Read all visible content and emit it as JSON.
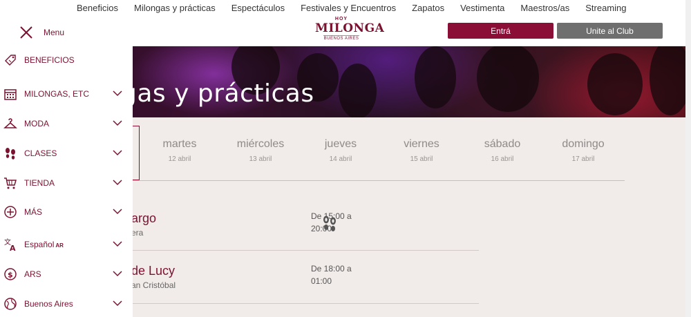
{
  "topnav": {
    "items": [
      "Beneficios",
      "Milongas y prácticas",
      "Espectáculos",
      "Festivales y Encuentros",
      "Zapatos",
      "Vestimenta",
      "Maestros/as",
      "Streaming"
    ]
  },
  "header": {
    "logo_top": "HOY",
    "logo_main": "MILONGA",
    "logo_bottom": "BUENOS AIRES",
    "login_label": "Entrá",
    "join_label": "Unite al Club"
  },
  "hero": {
    "title": "gas y prácticas"
  },
  "days": [
    {
      "name": "martes",
      "date": "12 abril"
    },
    {
      "name": "miércoles",
      "date": "13 abril"
    },
    {
      "name": "jueves",
      "date": "14 abril"
    },
    {
      "name": "viernes",
      "date": "15 abril"
    },
    {
      "name": "sábado",
      "date": "16 abril"
    },
    {
      "name": "domingo",
      "date": "17 abril"
    }
  ],
  "events": [
    {
      "title": "argo",
      "subtitle": "era",
      "time_line1": "De 15:00 a",
      "time_line2": "20:00"
    },
    {
      "title": "de Lucy",
      "subtitle": "an Cristóbal",
      "time_line1": "De 18:00 a",
      "time_line2": "01:00"
    }
  ],
  "sidebar": {
    "menu_label": "Menu",
    "items": [
      {
        "label": "BENEFICIOS",
        "icon": "tag-icon"
      },
      {
        "label": "MILONGAS, ETC",
        "icon": "calendar-icon"
      },
      {
        "label": "MODA",
        "icon": "hanger-icon"
      },
      {
        "label": "CLASES",
        "icon": "footprints-icon"
      },
      {
        "label": "TIENDA",
        "icon": "cart-icon"
      },
      {
        "label": "MÁS",
        "icon": "plus-circle-icon"
      },
      {
        "label": "Español",
        "suffix": "AR",
        "icon": "translate-icon"
      },
      {
        "label": "ARS",
        "icon": "currency-icon"
      },
      {
        "label": "Buenos Aires",
        "icon": "globe-icon"
      }
    ]
  },
  "colors": {
    "brand": "#8b0e36",
    "secondary_button": "#6f6f6f",
    "page_bg": "#f1ebe9"
  }
}
